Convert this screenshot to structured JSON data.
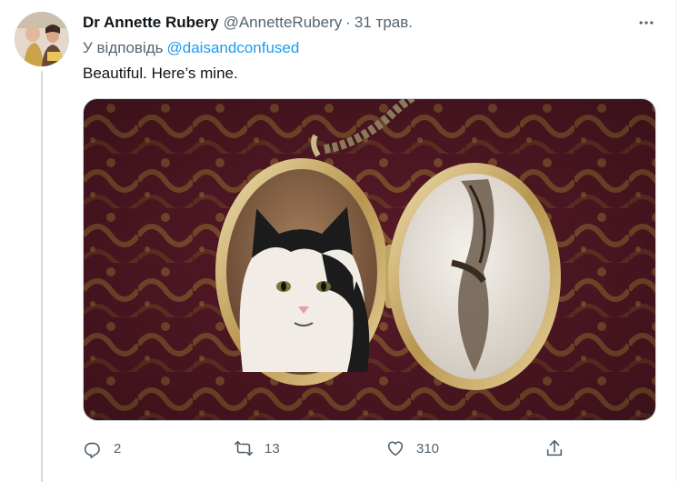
{
  "tweet": {
    "author_name": "Dr Annette Rubery",
    "handle": "@AnnetteRubery",
    "separator": "·",
    "date": "31 трав.",
    "reply_prefix": "У відповідь",
    "reply_to": "@daisandconfused",
    "text": "Beautiful. Here’s mine."
  },
  "media": {
    "description_icon": "photo",
    "colors": {
      "fabric": "#5a1a28",
      "pattern": "#b07a3a",
      "gold": "#c9a860",
      "cat_white": "#f1ece6",
      "cat_black": "#1b1b1b"
    }
  },
  "actions": {
    "reply_count": "2",
    "retweet_count": "13",
    "like_count": "310"
  },
  "icons": [
    "more-icon",
    "reply-icon",
    "retweet-icon",
    "like-icon",
    "share-icon"
  ]
}
